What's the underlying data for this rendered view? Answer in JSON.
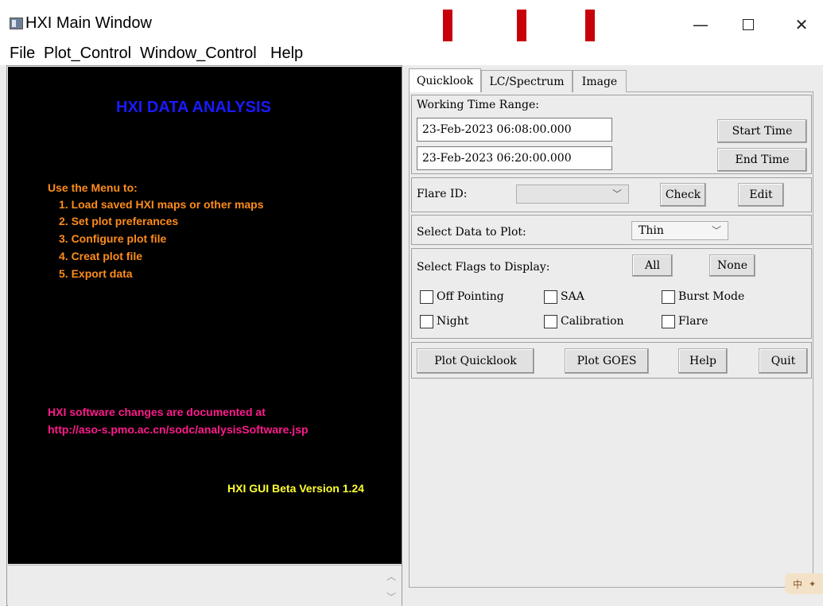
{
  "window": {
    "title": "HXI Main Window"
  },
  "menu": [
    "File",
    "Plot_Control",
    "Window_Control",
    "Help"
  ],
  "canvas": {
    "heading": "HXI DATA ANALYSIS",
    "menu_intro": "Use the Menu to:",
    "steps": [
      "1. Load saved HXI maps or other maps",
      "2. Set plot preferances",
      "3. Configure plot file",
      "4. Creat plot file",
      "5. Export data"
    ],
    "changes_line1": "HXI software changes are documented at",
    "changes_url": "http://aso-s.pmo.ac.cn/sodc/analysisSoftware.jsp",
    "version": "HXI GUI Beta Version 1.24"
  },
  "tabs": [
    "Quicklook",
    "LC/Spectrum",
    "Image"
  ],
  "time_range": {
    "label": "Working Time Range:",
    "start_value": "23-Feb-2023 06:08:00.000",
    "end_value": "23-Feb-2023 06:20:00.000",
    "start_button": "Start Time",
    "end_button": "End  Time"
  },
  "flare": {
    "label": "Flare ID:",
    "selected": "",
    "check_button": "Check",
    "edit_button": "Edit"
  },
  "data_select": {
    "label": "Select Data to Plot:",
    "selected": "Thin"
  },
  "flags": {
    "label": "Select Flags to Display:",
    "all_button": "All",
    "none_button": "None",
    "items": [
      "Off Pointing",
      "SAA",
      "Burst Mode",
      "Night",
      "Calibration",
      "Flare"
    ],
    "checked": [
      false,
      false,
      false,
      false,
      false,
      false
    ]
  },
  "actions": {
    "plot_quicklook": "Plot Quicklook",
    "plot_goes": "Plot GOES",
    "help": "Help",
    "quit": "Quit"
  },
  "ime": "中",
  "colors": {
    "arrow": "#c8000a",
    "heading": "#1a1aff",
    "orange_text": "#ff8c1a",
    "magenta_text": "#ff1a8c",
    "version_text": "#ffff33"
  }
}
